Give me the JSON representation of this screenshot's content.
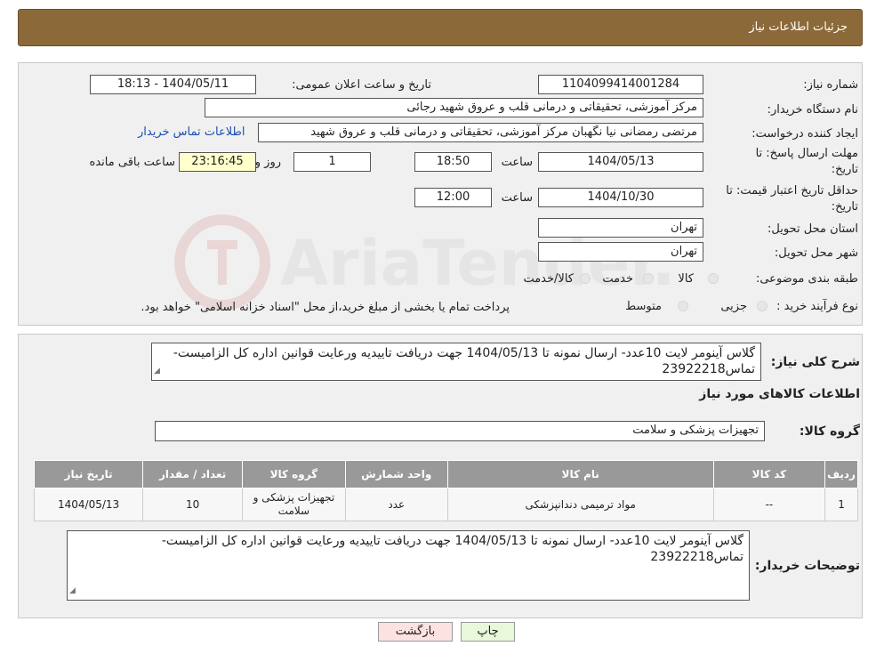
{
  "header": {
    "title": "جزئیات اطلاعات نیاز"
  },
  "form": {
    "need_number": {
      "label": "شماره نیاز:",
      "value": "1104099414001284"
    },
    "announce_datetime": {
      "label": "تاریخ و ساعت اعلان عمومی:",
      "value": "1404/05/11 - 18:13"
    },
    "buyer_org": {
      "label": "نام دستگاه خریدار:",
      "value": "مرکز آموزشی، تحقیقاتی و درمانی قلب و عروق شهید رجائی"
    },
    "requester": {
      "label": "ایجاد کننده درخواست:",
      "value": "مرتضی رمضانی نیا نگهبان مرکز آموزشی، تحقیقاتی و درمانی قلب و عروق شهید",
      "contact_link": "اطلاعات تماس خریدار"
    },
    "reply_deadline": {
      "label_line1": "مهلت ارسال پاسخ: تا",
      "label_line2": "تاریخ:",
      "date": "1404/05/13",
      "time_label": "ساعت",
      "time": "18:50",
      "days": "1",
      "days_label": "روز و",
      "remaining": "23:16:45",
      "remaining_label": "ساعت باقی مانده"
    },
    "price_validity": {
      "label_line1": "حداقل تاریخ اعتبار قیمت: تا",
      "label_line2": "تاریخ:",
      "date": "1404/10/30",
      "time_label": "ساعت",
      "time": "12:00"
    },
    "province": {
      "label": "استان محل تحویل:",
      "value": "تهران"
    },
    "city": {
      "label": "شهر محل تحویل:",
      "value": "تهران"
    },
    "category": {
      "label": "طبقه بندی موضوعی:",
      "options": [
        "کالا",
        "خدمت",
        "کالا/خدمت"
      ]
    },
    "purchase_type": {
      "label": "نوع فرآیند خرید :",
      "options": [
        "جزیی",
        "متوسط"
      ],
      "note": "پرداخت تمام یا بخشی از مبلغ خرید،از محل \"اسناد خزانه اسلامی\" خواهد بود."
    }
  },
  "summary": {
    "label": "شرح کلی نیاز:",
    "text": "گلاس آینومر لایت 10عدد- ارسال نمونه تا 1404/05/13 جهت دریافت تاییدیه ورعایت قوانین اداره کل الزامیست- تماس23922218"
  },
  "goods_section": {
    "title": "اطلاعات کالاهای مورد نیاز",
    "group_label": "گروه کالا:",
    "group_value": "تجهیزات پزشکی و سلامت"
  },
  "table": {
    "headers": [
      "ردیف",
      "کد کالا",
      "نام کالا",
      "واحد شمارش",
      "گروه کالا",
      "تعداد / مقدار",
      "تاریخ نیاز"
    ],
    "rows": [
      [
        "1",
        "--",
        "مواد ترمیمی دندانپزشکی",
        "عدد",
        "تجهیزات پزشکی و سلامت",
        "10",
        "1404/05/13"
      ]
    ]
  },
  "buyer_notes": {
    "label": "توضیحات خریدار:",
    "text": "گلاس آینومر لایت 10عدد- ارسال نمونه تا 1404/05/13 جهت دریافت تاییدیه ورعایت قوانین اداره کل الزامیست- تماس23922218"
  },
  "buttons": {
    "print": "چاپ",
    "back": "بازگشت"
  },
  "colors": {
    "header_bg": "#8b6939",
    "print_bg": "#e8f8d8",
    "back_bg": "#fde2e2",
    "link": "#1a4fb3"
  }
}
